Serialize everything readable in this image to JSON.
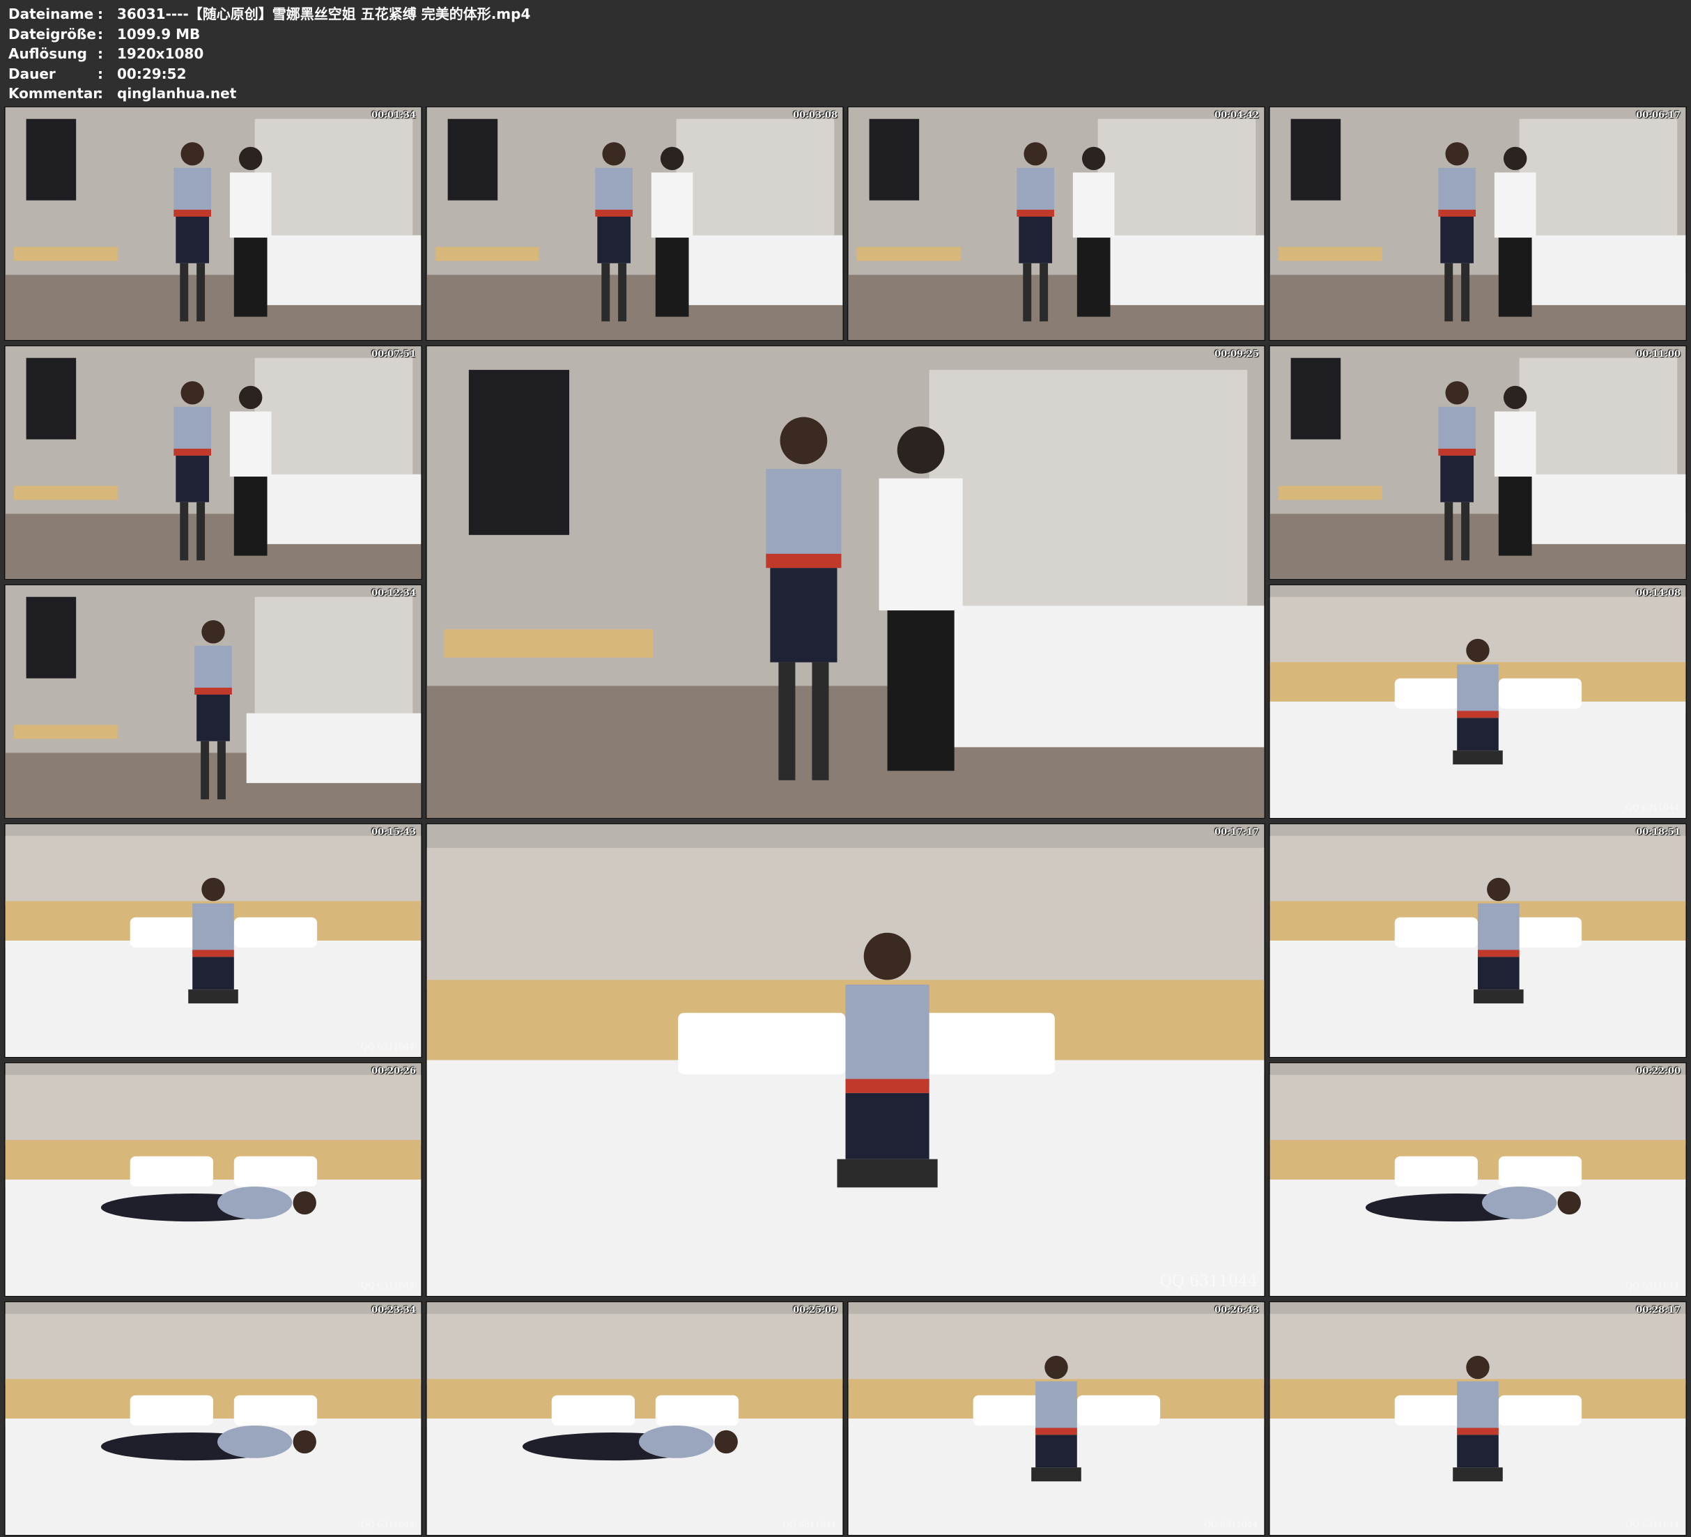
{
  "header": {
    "filename_label": "Dateiname",
    "filename": "36031----【随心原创】雪娜黑丝空姐 五花紧缚 完美的体形.mp4",
    "filesize_label": "Dateigröße",
    "filesize": "1099.9 MB",
    "resolution_label": "Auflösung",
    "resolution": "1920x1080",
    "duration_label": "Dauer",
    "duration": "00:29:52",
    "comment_label": "Kommentar",
    "comment": "qinglanhua.net",
    "separator": ":"
  },
  "thumbnails": [
    {
      "time": "00:01:34",
      "scene": "standing-room",
      "watermark": ""
    },
    {
      "time": "00:03:08",
      "scene": "standing-room",
      "watermark": ""
    },
    {
      "time": "00:04:42",
      "scene": "standing-close",
      "watermark": ""
    },
    {
      "time": "00:06:17",
      "scene": "standing-close",
      "watermark": ""
    },
    {
      "time": "00:07:51",
      "scene": "standing-room",
      "watermark": ""
    },
    {
      "time": "00:09:25",
      "scene": "standing-close",
      "watermark": ""
    },
    {
      "time": "00:11:00",
      "scene": "standing-close",
      "watermark": ""
    },
    {
      "time": "00:12:34",
      "scene": "doorway",
      "watermark": ""
    },
    {
      "time": "00:14:08",
      "scene": "bed-sitting",
      "watermark": "QQ 6311044"
    },
    {
      "time": "00:15:43",
      "scene": "bed-sitting",
      "watermark": "QQ 6311044"
    },
    {
      "time": "00:17:17",
      "scene": "bed-kneeling",
      "watermark": "QQ 6311044"
    },
    {
      "time": "00:18:51",
      "scene": "bed-kneeling",
      "watermark": ""
    },
    {
      "time": "00:20:26",
      "scene": "bed-lying",
      "watermark": "QQ 6311044"
    },
    {
      "time": "00:22:00",
      "scene": "bed-lying",
      "watermark": "QQ 6311044"
    },
    {
      "time": "00:23:34",
      "scene": "bed-lying",
      "watermark": "QQ 6311044"
    },
    {
      "time": "00:25:09",
      "scene": "bed-lying",
      "watermark": "QQ 6311044"
    },
    {
      "time": "00:26:43",
      "scene": "bed-sitting",
      "watermark": "QQ 6311044"
    },
    {
      "time": "00:28:17",
      "scene": "bed-sitting",
      "watermark": "QQ 6311044"
    }
  ]
}
